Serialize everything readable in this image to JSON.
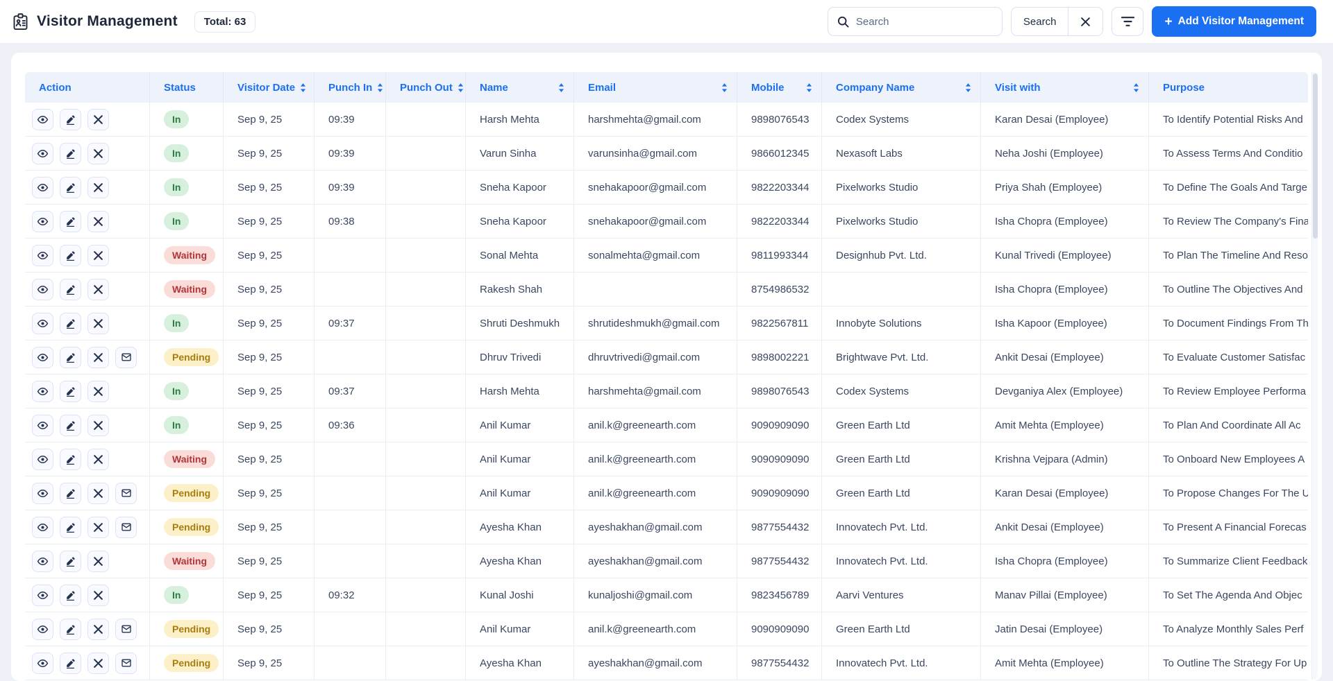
{
  "header": {
    "title": "Visitor Management",
    "total_label": "Total: 63",
    "search_placeholder": "Search",
    "search_button_label": "Search",
    "add_button_plus": "+",
    "add_button_label": "Add Visitor Management"
  },
  "icons": {
    "title": "id-badge",
    "search": "magnifier",
    "clear_search": "x",
    "filter": "filter-lines",
    "sort": "up-down-arrows",
    "view": "eye",
    "edit": "pencil",
    "delete": "x",
    "mail": "envelope"
  },
  "colors": {
    "accent": "#1a6ff3",
    "title_text": "#1d2739",
    "cell_text": "#3a4760",
    "status": {
      "In": {
        "bg": "#d7f0de",
        "text": "#2a7d43"
      },
      "Waiting": {
        "bg": "#fadcd9",
        "text": "#b13438"
      },
      "Pending": {
        "bg": "#fcf0c8",
        "text": "#a87c0e"
      }
    }
  },
  "table": {
    "columns": [
      {
        "label": "Action",
        "sortable": false
      },
      {
        "label": "Status",
        "sortable": false
      },
      {
        "label": "Visitor Date",
        "sortable": true
      },
      {
        "label": "Punch In",
        "sortable": true
      },
      {
        "label": "Punch Out",
        "sortable": true
      },
      {
        "label": "Name",
        "sortable": true
      },
      {
        "label": "Email",
        "sortable": true
      },
      {
        "label": "Mobile",
        "sortable": true
      },
      {
        "label": "Company Name",
        "sortable": true
      },
      {
        "label": "Visit with",
        "sortable": true
      },
      {
        "label": "Purpose",
        "sortable": false
      }
    ],
    "rows": [
      {
        "status": "In",
        "mail": false,
        "visitor_date": "Sep 9, 25",
        "punch_in": "09:39",
        "punch_out": "",
        "name": "Harsh Mehta",
        "email": "harshmehta@gmail.com",
        "mobile": "9898076543",
        "company": "Codex Systems",
        "visit_with": "Karan Desai (Employee)",
        "purpose": "To Identify Potential Risks And"
      },
      {
        "status": "In",
        "mail": false,
        "visitor_date": "Sep 9, 25",
        "punch_in": "09:39",
        "punch_out": "",
        "name": "Varun Sinha",
        "email": "varunsinha@gmail.com",
        "mobile": "9866012345",
        "company": "Nexasoft Labs",
        "visit_with": "Neha Joshi (Employee)",
        "purpose": "To Assess Terms And Conditio"
      },
      {
        "status": "In",
        "mail": false,
        "visitor_date": "Sep 9, 25",
        "punch_in": "09:39",
        "punch_out": "",
        "name": "Sneha Kapoor",
        "email": "snehakapoor@gmail.com",
        "mobile": "9822203344",
        "company": "Pixelworks Studio",
        "visit_with": "Priya Shah (Employee)",
        "purpose": "To Define The Goals And Targe"
      },
      {
        "status": "In",
        "mail": false,
        "visitor_date": "Sep 9, 25",
        "punch_in": "09:38",
        "punch_out": "",
        "name": "Sneha Kapoor",
        "email": "snehakapoor@gmail.com",
        "mobile": "9822203344",
        "company": "Pixelworks Studio",
        "visit_with": "Isha Chopra (Employee)",
        "purpose": "To Review The Company's Fina"
      },
      {
        "status": "Waiting",
        "mail": false,
        "visitor_date": "Sep 9, 25",
        "punch_in": "",
        "punch_out": "",
        "name": "Sonal Mehta",
        "email": "sonalmehta@gmail.com",
        "mobile": "9811993344",
        "company": "Designhub Pvt. Ltd.",
        "visit_with": "Kunal Trivedi (Employee)",
        "purpose": "To Plan The Timeline And Reso"
      },
      {
        "status": "Waiting",
        "mail": false,
        "visitor_date": "Sep 9, 25",
        "punch_in": "",
        "punch_out": "",
        "name": "Rakesh Shah",
        "email": "",
        "mobile": "8754986532",
        "company": "",
        "visit_with": "Isha Chopra (Employee)",
        "purpose": "To Outline The Objectives And"
      },
      {
        "status": "In",
        "mail": false,
        "visitor_date": "Sep 9, 25",
        "punch_in": "09:37",
        "punch_out": "",
        "name": "Shruti Deshmukh",
        "email": "shrutideshmukh@gmail.com",
        "mobile": "9822567811",
        "company": "Innobyte Solutions",
        "visit_with": "Isha Kapoor (Employee)",
        "purpose": "To Document Findings From Th"
      },
      {
        "status": "Pending",
        "mail": true,
        "visitor_date": "Sep 9, 25",
        "punch_in": "",
        "punch_out": "",
        "name": "Dhruv Trivedi",
        "email": "dhruvtrivedi@gmail.com",
        "mobile": "9898002221",
        "company": "Brightwave Pvt. Ltd.",
        "visit_with": "Ankit Desai (Employee)",
        "purpose": "To Evaluate Customer Satisfac"
      },
      {
        "status": "In",
        "mail": false,
        "visitor_date": "Sep 9, 25",
        "punch_in": "09:37",
        "punch_out": "",
        "name": "Harsh Mehta",
        "email": "harshmehta@gmail.com",
        "mobile": "9898076543",
        "company": "Codex Systems",
        "visit_with": "Devganiya Alex (Employee)",
        "purpose": "To Review Employee Performa"
      },
      {
        "status": "In",
        "mail": false,
        "visitor_date": "Sep 9, 25",
        "punch_in": "09:36",
        "punch_out": "",
        "name": "Anil Kumar",
        "email": "anil.k@greenearth.com",
        "mobile": "9090909090",
        "company": "Green Earth Ltd",
        "visit_with": "Amit Mehta (Employee)",
        "purpose": "To Plan And Coordinate All Ac"
      },
      {
        "status": "Waiting",
        "mail": false,
        "visitor_date": "Sep 9, 25",
        "punch_in": "",
        "punch_out": "",
        "name": "Anil Kumar",
        "email": "anil.k@greenearth.com",
        "mobile": "9090909090",
        "company": "Green Earth Ltd",
        "visit_with": "Krishna Vejpara (Admin)",
        "purpose": "To Onboard New Employees A"
      },
      {
        "status": "Pending",
        "mail": true,
        "visitor_date": "Sep 9, 25",
        "punch_in": "",
        "punch_out": "",
        "name": "Anil Kumar",
        "email": "anil.k@greenearth.com",
        "mobile": "9090909090",
        "company": "Green Earth Ltd",
        "visit_with": "Karan Desai (Employee)",
        "purpose": "To Propose Changes For The U"
      },
      {
        "status": "Pending",
        "mail": true,
        "visitor_date": "Sep 9, 25",
        "punch_in": "",
        "punch_out": "",
        "name": "Ayesha Khan",
        "email": "ayeshakhan@gmail.com",
        "mobile": "9877554432",
        "company": "Innovatech Pvt. Ltd.",
        "visit_with": "Ankit Desai (Employee)",
        "purpose": "To Present A Financial Forecas"
      },
      {
        "status": "Waiting",
        "mail": false,
        "visitor_date": "Sep 9, 25",
        "punch_in": "",
        "punch_out": "",
        "name": "Ayesha Khan",
        "email": "ayeshakhan@gmail.com",
        "mobile": "9877554432",
        "company": "Innovatech Pvt. Ltd.",
        "visit_with": "Isha Chopra (Employee)",
        "purpose": "To Summarize Client Feedback"
      },
      {
        "status": "In",
        "mail": false,
        "visitor_date": "Sep 9, 25",
        "punch_in": "09:32",
        "punch_out": "",
        "name": "Kunal Joshi",
        "email": "kunaljoshi@gmail.com",
        "mobile": "9823456789",
        "company": "Aarvi Ventures",
        "visit_with": "Manav Pillai (Employee)",
        "purpose": "To Set The Agenda And Objec"
      },
      {
        "status": "Pending",
        "mail": true,
        "visitor_date": "Sep 9, 25",
        "punch_in": "",
        "punch_out": "",
        "name": "Anil Kumar",
        "email": "anil.k@greenearth.com",
        "mobile": "9090909090",
        "company": "Green Earth Ltd",
        "visit_with": "Jatin Desai (Employee)",
        "purpose": "To Analyze Monthly Sales Perf"
      },
      {
        "status": "Pending",
        "mail": true,
        "visitor_date": "Sep 9, 25",
        "punch_in": "",
        "punch_out": "",
        "name": "Ayesha Khan",
        "email": "ayeshakhan@gmail.com",
        "mobile": "9877554432",
        "company": "Innovatech Pvt. Ltd.",
        "visit_with": "Amit Mehta (Employee)",
        "purpose": "To Outline The Strategy For Up"
      }
    ]
  }
}
